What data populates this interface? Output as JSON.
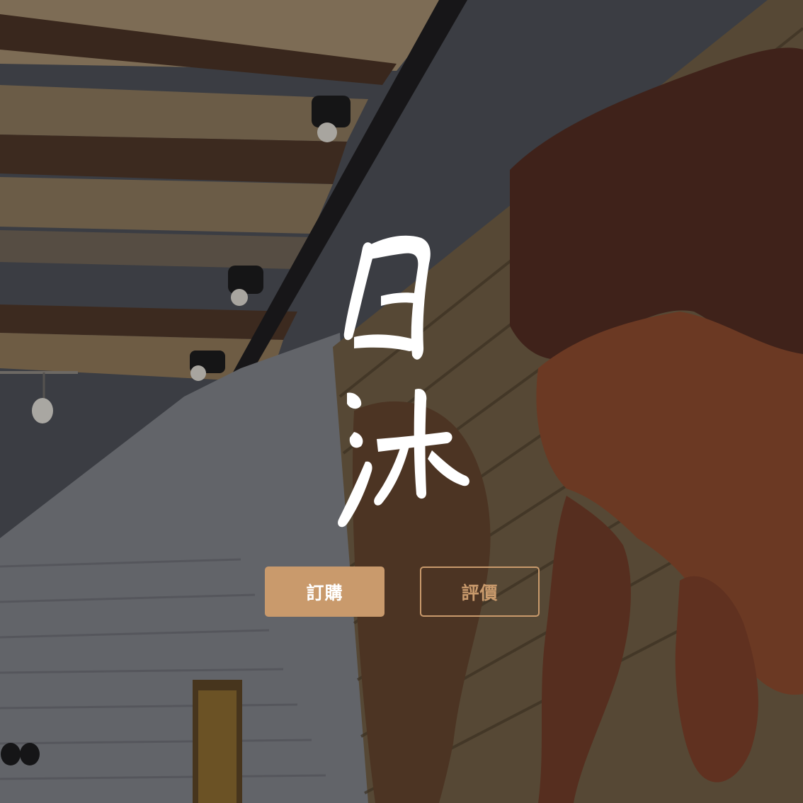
{
  "brand": {
    "logo_text": "日沐",
    "logo_color": "#ffffff"
  },
  "background": {
    "overlay_color": "#000000",
    "accent_color": "#c99a6c"
  },
  "actions": {
    "order_label": "訂購",
    "review_label": "評價"
  }
}
